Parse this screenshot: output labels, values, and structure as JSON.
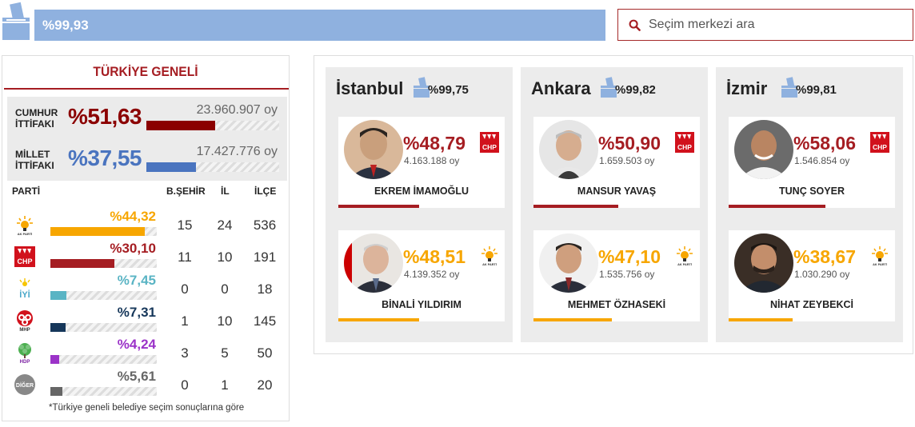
{
  "topbar": {
    "progress_text": "%99,93",
    "progress_color": "#8fb1df",
    "search_placeholder": "Seçim merkezi ara",
    "icons": [
      "ballot-box-icon",
      "search-icon"
    ]
  },
  "turkey": {
    "title": "TÜRKİYE GENELİ",
    "alliances": [
      {
        "name_line1": "CUMHUR",
        "name_line2": "İTTİFAKI",
        "pct": "%51,63",
        "votes": "23.960.907 oy",
        "share": 51.63,
        "color": "#8b0000"
      },
      {
        "name_line1": "MİLLET",
        "name_line2": "İTTİFAKI",
        "pct": "%37,55",
        "votes": "17.427.776 oy",
        "share": 37.55,
        "color": "#4a74bf"
      }
    ],
    "headers": {
      "party": "PARTİ",
      "bsehir": "B.ŞEHİR",
      "il": "İL",
      "ilce": "İLÇE"
    },
    "parties": [
      {
        "logo": "akp-logo-icon",
        "pct": "%44,32",
        "share": 44.32,
        "color": "#f7a600",
        "bsehir": "15",
        "il": "24",
        "ilce": "536"
      },
      {
        "logo": "chp-logo-icon",
        "pct": "%30,10",
        "share": 30.1,
        "color": "#a51d22",
        "bsehir": "11",
        "il": "10",
        "ilce": "191"
      },
      {
        "logo": "iyi-logo-icon",
        "pct": "%7,45",
        "share": 7.45,
        "color": "#5ab4c4",
        "bsehir": "0",
        "il": "0",
        "ilce": "18"
      },
      {
        "logo": "mhp-logo-icon",
        "pct": "%7,31",
        "share": 7.31,
        "color": "#16375a",
        "bsehir": "1",
        "il": "10",
        "ilce": "145"
      },
      {
        "logo": "hdp-logo-icon",
        "pct": "%4,24",
        "share": 4.24,
        "color": "#9b33c8",
        "bsehir": "3",
        "il": "5",
        "ilce": "50"
      },
      {
        "logo": "diger-logo-icon",
        "pct": "%5,61",
        "share": 5.61,
        "color": "#666666",
        "bsehir": "0",
        "il": "1",
        "ilce": "20"
      }
    ],
    "footnote": "*Türkiye geneli belediye seçim sonuçlarına göre"
  },
  "cities": [
    {
      "name": "İstanbul",
      "pct": "%99,75",
      "candidates": [
        {
          "pct": "%48,79",
          "votes": "4.163.188 oy",
          "name": "EKREM İMAMOĞLU",
          "party": "CHP",
          "color": "#a51d22"
        },
        {
          "pct": "%48,51",
          "votes": "4.139.352 oy",
          "name": "BİNALİ YILDIRIM",
          "party": "AKP",
          "color": "#f7a600"
        }
      ]
    },
    {
      "name": "Ankara",
      "pct": "%99,82",
      "candidates": [
        {
          "pct": "%50,90",
          "votes": "1.659.503 oy",
          "name": "MANSUR YAVAŞ",
          "party": "CHP",
          "color": "#a51d22"
        },
        {
          "pct": "%47,10",
          "votes": "1.535.756 oy",
          "name": "MEHMET ÖZHASEKİ",
          "party": "AKP",
          "color": "#f7a600"
        }
      ]
    },
    {
      "name": "İzmir",
      "pct": "%99,81",
      "candidates": [
        {
          "pct": "%58,06",
          "votes": "1.546.854 oy",
          "name": "TUNÇ SOYER",
          "party": "CHP",
          "color": "#a51d22"
        },
        {
          "pct": "%38,67",
          "votes": "1.030.290 oy",
          "name": "NİHAT ZEYBEKCİ",
          "party": "AKP",
          "color": "#f7a600"
        }
      ]
    }
  ],
  "logo_text": {
    "chp": "CHP",
    "akp": "AK PARTİ",
    "iyi": "İYİ",
    "mhp": "MHP",
    "hdp": "HDP",
    "diger": "DİĞER"
  }
}
